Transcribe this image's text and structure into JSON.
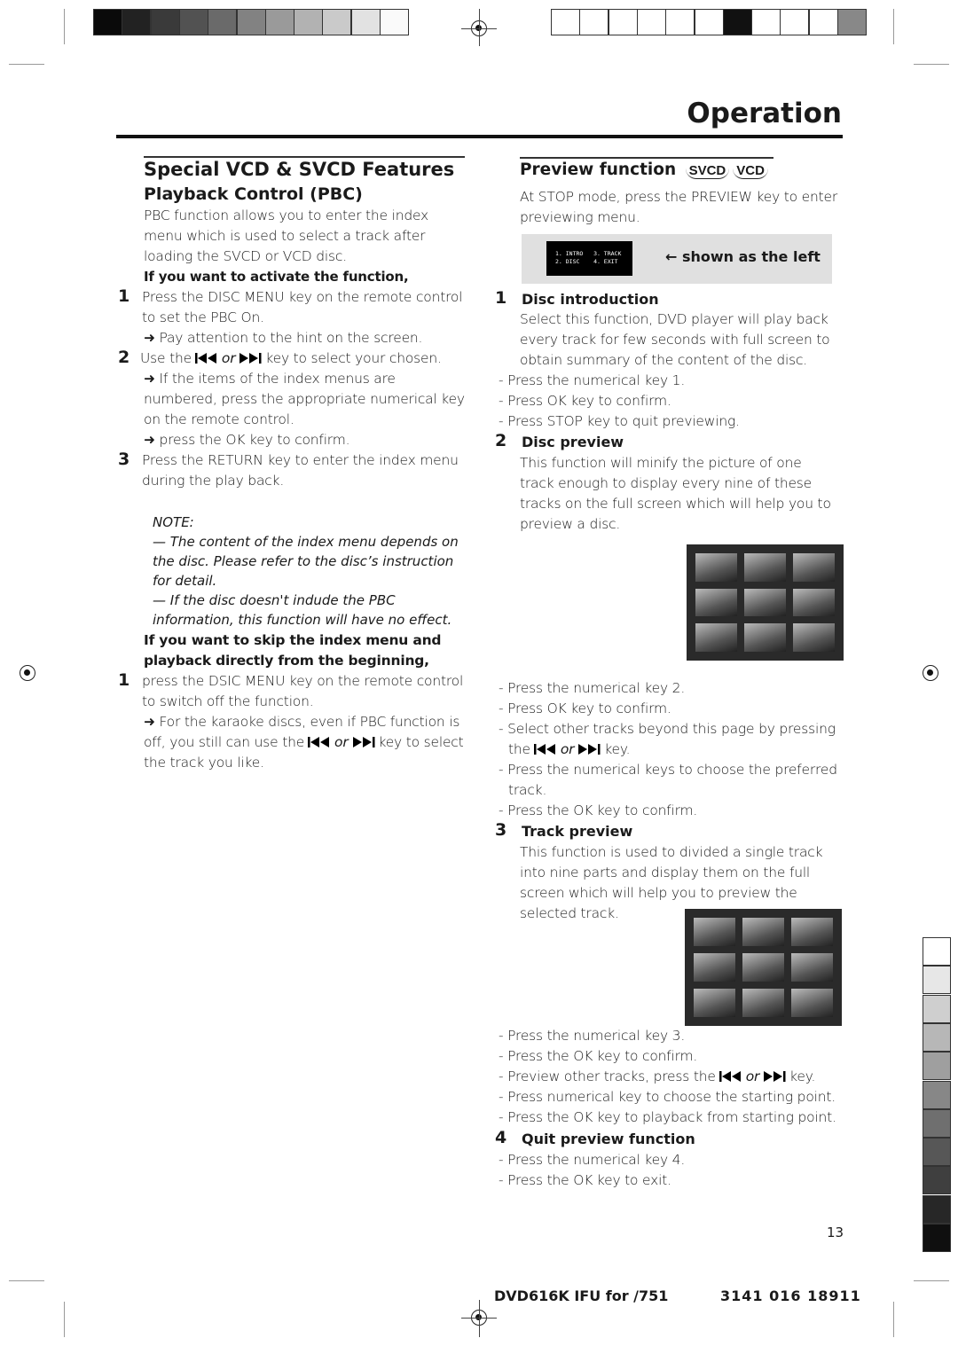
{
  "header": {
    "title": "Operation"
  },
  "left": {
    "section_title": "Special VCD & SVCD Features",
    "subtitle": "Playback Control (PBC)",
    "intro": "PBC function allows you to enter the index menu which is used to select a track after loading the SVCD or VCD disc.",
    "activate_heading": "If you want to activate the function,",
    "step1_num": "1",
    "step1": "Press the DISC MENU key on the remote control to set the PBC On.",
    "step1_hint": "Pay attention to the hint on the screen.",
    "step2_num": "2",
    "step2_a": "Use the",
    "step2_or": "or",
    "step2_b": "key to select your chosen.",
    "step2_hint": "If the items of the index menus are numbered, press the appropriate numerical key on the remote control.",
    "step2_hint2": "press the OK key to confirm.",
    "step3_num": "3",
    "step3": "Press the RETURN key to enter the index menu during the play back.",
    "note_label": "NOTE:",
    "note1": "— The content of the index menu depends on the disc. Please refer to the disc’s instruction for detail.",
    "note2": "— If the disc doesn't indude the PBC information, this function will have no effect.",
    "skip_heading": "If you want to skip the index menu and playback directly from the beginning,",
    "skip1_num": "1",
    "skip1": "press the DSIC MENU key on the remote control to switch off the function.",
    "skip1_hint_a": "For the karaoke discs, even if PBC function is off, you still can use the",
    "skip1_or": "or",
    "skip1_hint_b": "key to select the track you like."
  },
  "right": {
    "title": "Preview function",
    "badge1": "SVCD",
    "badge2": "VCD",
    "intro": "At STOP mode, press the PREVIEW key to enter previewing menu.",
    "menu_screen": {
      "l1a": "1. INTRO",
      "l1b": "3. TRACK",
      "l2a": "2. DISC",
      "l2b": "4. EXIT"
    },
    "shown_label": "← shown as the left",
    "s1_num": "1",
    "s1_title": "Disc introduction",
    "s1_text": "Select this function, DVD player will play back every track for few seconds with full screen to obtain summary of the content of the disc.",
    "s1_steps": [
      "- Press the numerical key 1.",
      "- Press OK key to confirm.",
      "- Press STOP key to quit previewing."
    ],
    "s2_num": "2",
    "s2_title": "Disc preview",
    "s2_text": "This function will minify the picture of one track enough to display every nine of these tracks on the full screen which will help you to preview a disc.",
    "s2_steps": [
      "- Press the numerical key 2.",
      "- Press OK key to confirm.",
      "- Select other tracks beyond this page by pressing"
    ],
    "s2_key_a": "the",
    "s2_or": "or",
    "s2_key_b": "key.",
    "s2_steps2": [
      "- Press the numerical keys to choose the preferred",
      "track.",
      "- Press the OK key to confirm."
    ],
    "s3_num": "3",
    "s3_title": "Track preview",
    "s3_text": "This function is used to divided a single track into nine parts and display them on the full screen which will help you to preview the selected track.",
    "s3_steps": [
      "- Press the numerical key 3.",
      "- Press the OK key to confirm."
    ],
    "s3_prev_a": "- Preview other tracks, press the",
    "s3_or": "or",
    "s3_prev_b": "key.",
    "s3_steps2": [
      "- Press numerical key to choose the starting point.",
      "- Press the OK key to playback from starting point."
    ],
    "s4_num": "4",
    "s4_title": "Quit preview function",
    "s4_steps": [
      "- Press the numerical key 4.",
      "- Press the OK key to exit."
    ]
  },
  "page_number": "13",
  "footer": {
    "model": "DVD616K IFU for /751",
    "code": "3141 016 18911"
  },
  "colors": {
    "text": "#1a1a1a",
    "panel": "#e0e0e0",
    "screen": "#000000"
  }
}
